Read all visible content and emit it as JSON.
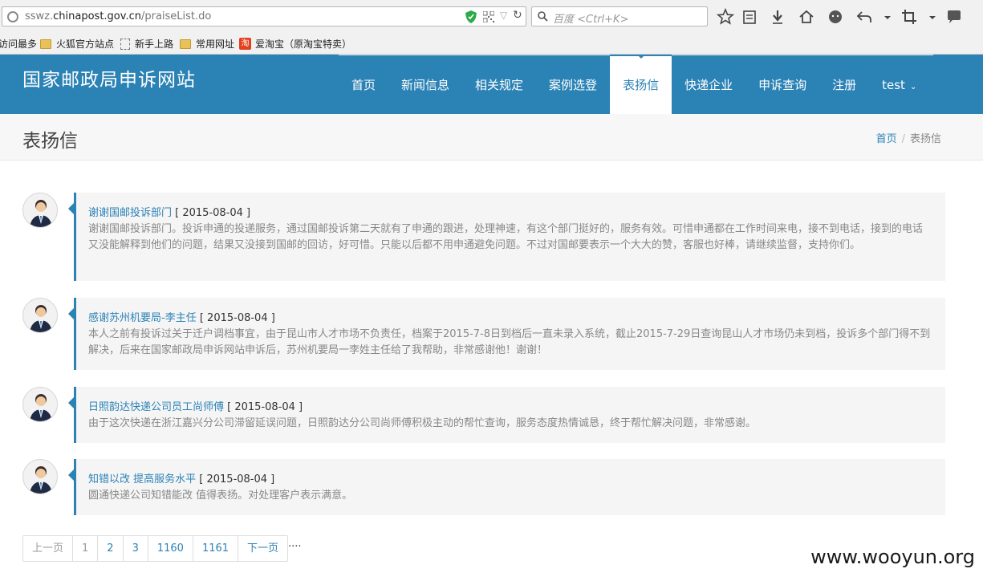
{
  "browser": {
    "url_prefix": "sswz.",
    "url_domain": "chinapost.gov.cn",
    "url_path": "/praiseList.do",
    "search_placeholder": "百度 <Ctrl+K>",
    "bookmarks": [
      "访问最多",
      "火狐官方站点",
      "新手上路",
      "常用网址",
      "爱淘宝（原淘宝特卖）"
    ],
    "taobao_glyph": "淘"
  },
  "site": {
    "title": "国家邮政局申诉网站",
    "nav": [
      "首页",
      "新闻信息",
      "相关规定",
      "案例选登",
      "表扬信",
      "快递企业",
      "申诉查询",
      "注册",
      "test"
    ],
    "active_nav_index": 4,
    "accent_color": "#2b82b5"
  },
  "page": {
    "title": "表扬信",
    "breadcrumb": {
      "home": "首页",
      "current": "表扬信"
    }
  },
  "letters": [
    {
      "title": "谢谢国邮投诉部门",
      "date": "[ 2015-08-04 ]",
      "body": "谢谢国邮投诉部门。投诉申通的投递服务，通过国邮投诉第二天就有了申通的跟进，处理神速，有这个部门挺好的，服务有效。可惜申通都在工作时间来电，接不到电话，接到的电话又没能解释到他们的问题，结果又没接到国邮的回访，好可惜。只能以后都不用申通避免问题。不过对国邮要表示一个大大的赞，客服也好棒，请继续监督，支持你们。"
    },
    {
      "title": "感谢苏州机要局-李主任",
      "date": "[ 2015-08-04 ]",
      "body": "本人之前有投诉过关于迁户调档事宜，由于昆山市人才市场不负责任，档案于2015-7-8日到档后一直未录入系统，截止2015-7-29日查询昆山人才市场仍未到档，投诉多个部门得不到解决，后来在国家邮政局申诉网站申诉后，苏州机要局一李姓主任给了我帮助，非常感谢他！谢谢！"
    },
    {
      "title": "日照韵达快递公司员工尚师傅",
      "date": "[ 2015-08-04 ]",
      "body": "由于这次快递在浙江嘉兴分公司滞留延误问题，日照韵达分公司尚师傅积极主动的帮忙查询，服务态度热情诚恳，终于帮忙解决问题，非常感谢。"
    },
    {
      "title": "知错以改 提高服务水平",
      "date": "[ 2015-08-04 ]",
      "body": "圆通快递公司知错能改 值得表扬。对处理客户表示满意。"
    }
  ],
  "pagination": {
    "prev": "上一页",
    "pages": [
      "1",
      "2",
      "3",
      "1160",
      "1161"
    ],
    "current": "1",
    "next": "下一页",
    "ellipsis": "...."
  },
  "watermark": "www.wooyun.org"
}
